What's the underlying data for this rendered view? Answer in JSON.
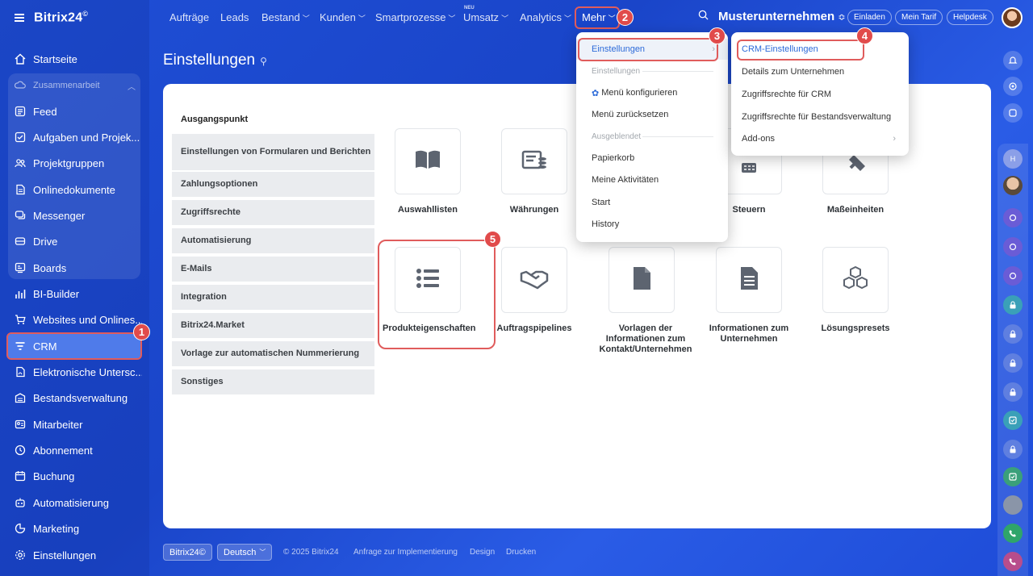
{
  "app": {
    "logo": "Bitrix24",
    "logo_mark": "©"
  },
  "sidebar": {
    "items": [
      {
        "label": "Startseite",
        "icon": "home-icon"
      },
      {
        "label": "Zusammenarbeit",
        "icon": "cloud-icon"
      },
      {
        "label": "Feed",
        "icon": "feed-icon"
      },
      {
        "label": "Aufgaben und Projek...",
        "icon": "task-icon"
      },
      {
        "label": "Projektgruppen",
        "icon": "group-icon"
      },
      {
        "label": "Onlinedokumente",
        "icon": "document-icon"
      },
      {
        "label": "Messenger",
        "icon": "messenger-icon"
      },
      {
        "label": "Drive",
        "icon": "drive-icon"
      },
      {
        "label": "Boards",
        "icon": "board-icon"
      },
      {
        "label": "BI-Builder",
        "icon": "chart-icon"
      },
      {
        "label": "Websites und Onlines...",
        "icon": "cart-icon"
      },
      {
        "label": "CRM",
        "icon": "filter-icon"
      },
      {
        "label": "Elektronische Untersc...",
        "icon": "signature-icon"
      },
      {
        "label": "Bestandsverwaltung",
        "icon": "inventory-icon"
      },
      {
        "label": "Mitarbeiter",
        "icon": "employee-icon"
      },
      {
        "label": "Abonnement",
        "icon": "subscription-icon"
      },
      {
        "label": "Buchung",
        "icon": "calendar-icon"
      },
      {
        "label": "Automatisierung",
        "icon": "robot-icon"
      },
      {
        "label": "Marketing",
        "icon": "marketing-icon"
      },
      {
        "label": "Einstellungen",
        "icon": "gear-icon"
      }
    ]
  },
  "topnav": {
    "items": [
      "Aufträge",
      "Leads",
      "Bestand",
      "Kunden",
      "Smartprozesse",
      "Umsatz",
      "Analytics",
      "Mehr"
    ],
    "neu_label": "NEU",
    "company": "Musterunternehmen",
    "buttons": [
      "Einladen",
      "Mein Tarif",
      "Helpdesk"
    ]
  },
  "page": {
    "title": "Einstellungen"
  },
  "settings": {
    "section_title": "Ausgangspunkt",
    "menu": [
      "Einstellungen von Formularen und Berichten",
      "Zahlungsoptionen",
      "Zugriffsrechte",
      "Automatisierung",
      "E-Mails",
      "Integration",
      "Bitrix24.Market",
      "Vorlage zur automatischen Nummerierung",
      "Sonstiges"
    ],
    "tiles": [
      {
        "label": "Auswahllisten",
        "icon": "book-icon"
      },
      {
        "label": "Währungen",
        "icon": "currency-icon"
      },
      {
        "label": "Steuern",
        "icon": "calculator-icon"
      },
      {
        "label": "Maßeinheiten",
        "icon": "ruler-icon"
      },
      {
        "label": "Produkteigenschaften",
        "icon": "list-icon"
      },
      {
        "label": "Auftragspipelines",
        "icon": "handshake-icon"
      },
      {
        "label": "Vorlagen der Informationen zum Kontakt/Unternehmen",
        "icon": "file-icon"
      },
      {
        "label": "Informationen zum Unternehmen",
        "icon": "document-lines-icon"
      },
      {
        "label": "Lösungspresets",
        "icon": "cubes-icon"
      }
    ]
  },
  "dropdown_mehr": {
    "items": [
      {
        "label": "Einstellungen",
        "type": "item"
      },
      {
        "label": "Einstellungen",
        "type": "header"
      },
      {
        "label": "Menü konfigurieren",
        "type": "item"
      },
      {
        "label": "Menü zurücksetzen",
        "type": "item"
      },
      {
        "label": "Ausgeblendet",
        "type": "header"
      },
      {
        "label": "Papierkorb",
        "type": "item"
      },
      {
        "label": "Meine Aktivitäten",
        "type": "item"
      },
      {
        "label": "Start",
        "type": "item"
      },
      {
        "label": "History",
        "type": "item"
      }
    ]
  },
  "dropdown_settings": {
    "items": [
      "CRM-Einstellungen",
      "Details zum Unternehmen",
      "Zugriffsrechte für CRM",
      "Zugriffsrechte für Bestandsverwaltung",
      "Add-ons"
    ]
  },
  "footer": {
    "logo": "Bitrix24©",
    "language": "Deutsch",
    "copyright": "© 2025 Bitrix24",
    "links": [
      "Anfrage zur Implementierung",
      "Design",
      "Drucken"
    ]
  },
  "badges": [
    "1",
    "2",
    "3",
    "4",
    "5"
  ],
  "colors": {
    "accent": "#1f4fd6",
    "highlight": "#e05c5c",
    "link": "#2d6bd9"
  }
}
